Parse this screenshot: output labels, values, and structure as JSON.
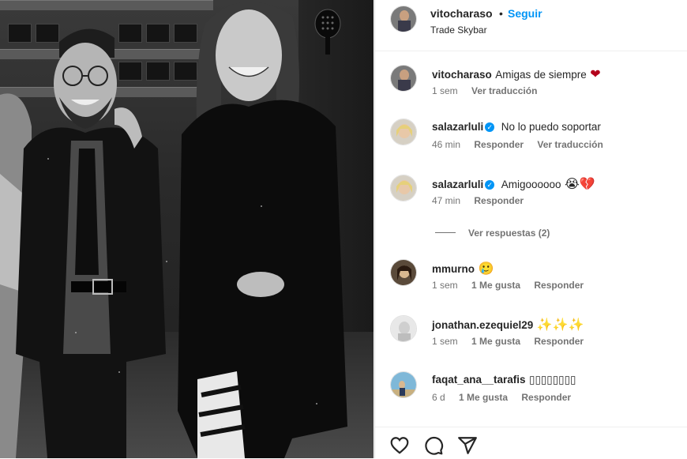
{
  "photo": {
    "alt_description": "",
    "icons": [
      "paddle-sign"
    ]
  },
  "header": {
    "username": "vitocharaso",
    "separator": "•",
    "follow_label": "Seguir",
    "location": "Trade Skybar"
  },
  "comments": [
    {
      "username": "vitocharaso",
      "verified": false,
      "text": "Amigas de siempre",
      "emoji": "❤",
      "meta": {
        "time": "1 sem",
        "likes": "",
        "reply": "",
        "translate": "Ver traducción"
      }
    },
    {
      "username": "salazarluli",
      "verified": true,
      "text": "No lo puedo soportar",
      "emoji": "",
      "meta": {
        "time": "46 min",
        "likes": "",
        "reply": "Responder",
        "translate": "Ver traducción"
      }
    },
    {
      "username": "salazarluli",
      "verified": true,
      "text": "Amigoooooo",
      "emoji": "😭💔",
      "meta": {
        "time": "47 min",
        "likes": "",
        "reply": "Responder",
        "translate": ""
      }
    },
    {
      "username": "mmurno",
      "verified": false,
      "text": "",
      "emoji": "🥲",
      "meta": {
        "time": "1 sem",
        "likes": "1 Me gusta",
        "reply": "Responder",
        "translate": ""
      }
    },
    {
      "username": "jonathan.ezequiel29",
      "verified": false,
      "text": "",
      "emoji": "✨✨✨",
      "meta": {
        "time": "1 sem",
        "likes": "1 Me gusta",
        "reply": "Responder",
        "translate": ""
      }
    },
    {
      "username": "faqat_ana__tarafis",
      "verified": false,
      "text": "▯▯▯▯▯▯▯▯",
      "emoji": "",
      "meta": {
        "time": "6 d",
        "likes": "1 Me gusta",
        "reply": "Responder",
        "translate": ""
      }
    }
  ],
  "view_replies": "Ver respuestas (2)",
  "action_bar": {
    "icons": [
      "heart-icon",
      "comment-icon",
      "share-icon"
    ]
  },
  "colors": {
    "accent": "#0095f6",
    "muted": "#737373",
    "text": "#262626",
    "heart": "#b3001b"
  }
}
